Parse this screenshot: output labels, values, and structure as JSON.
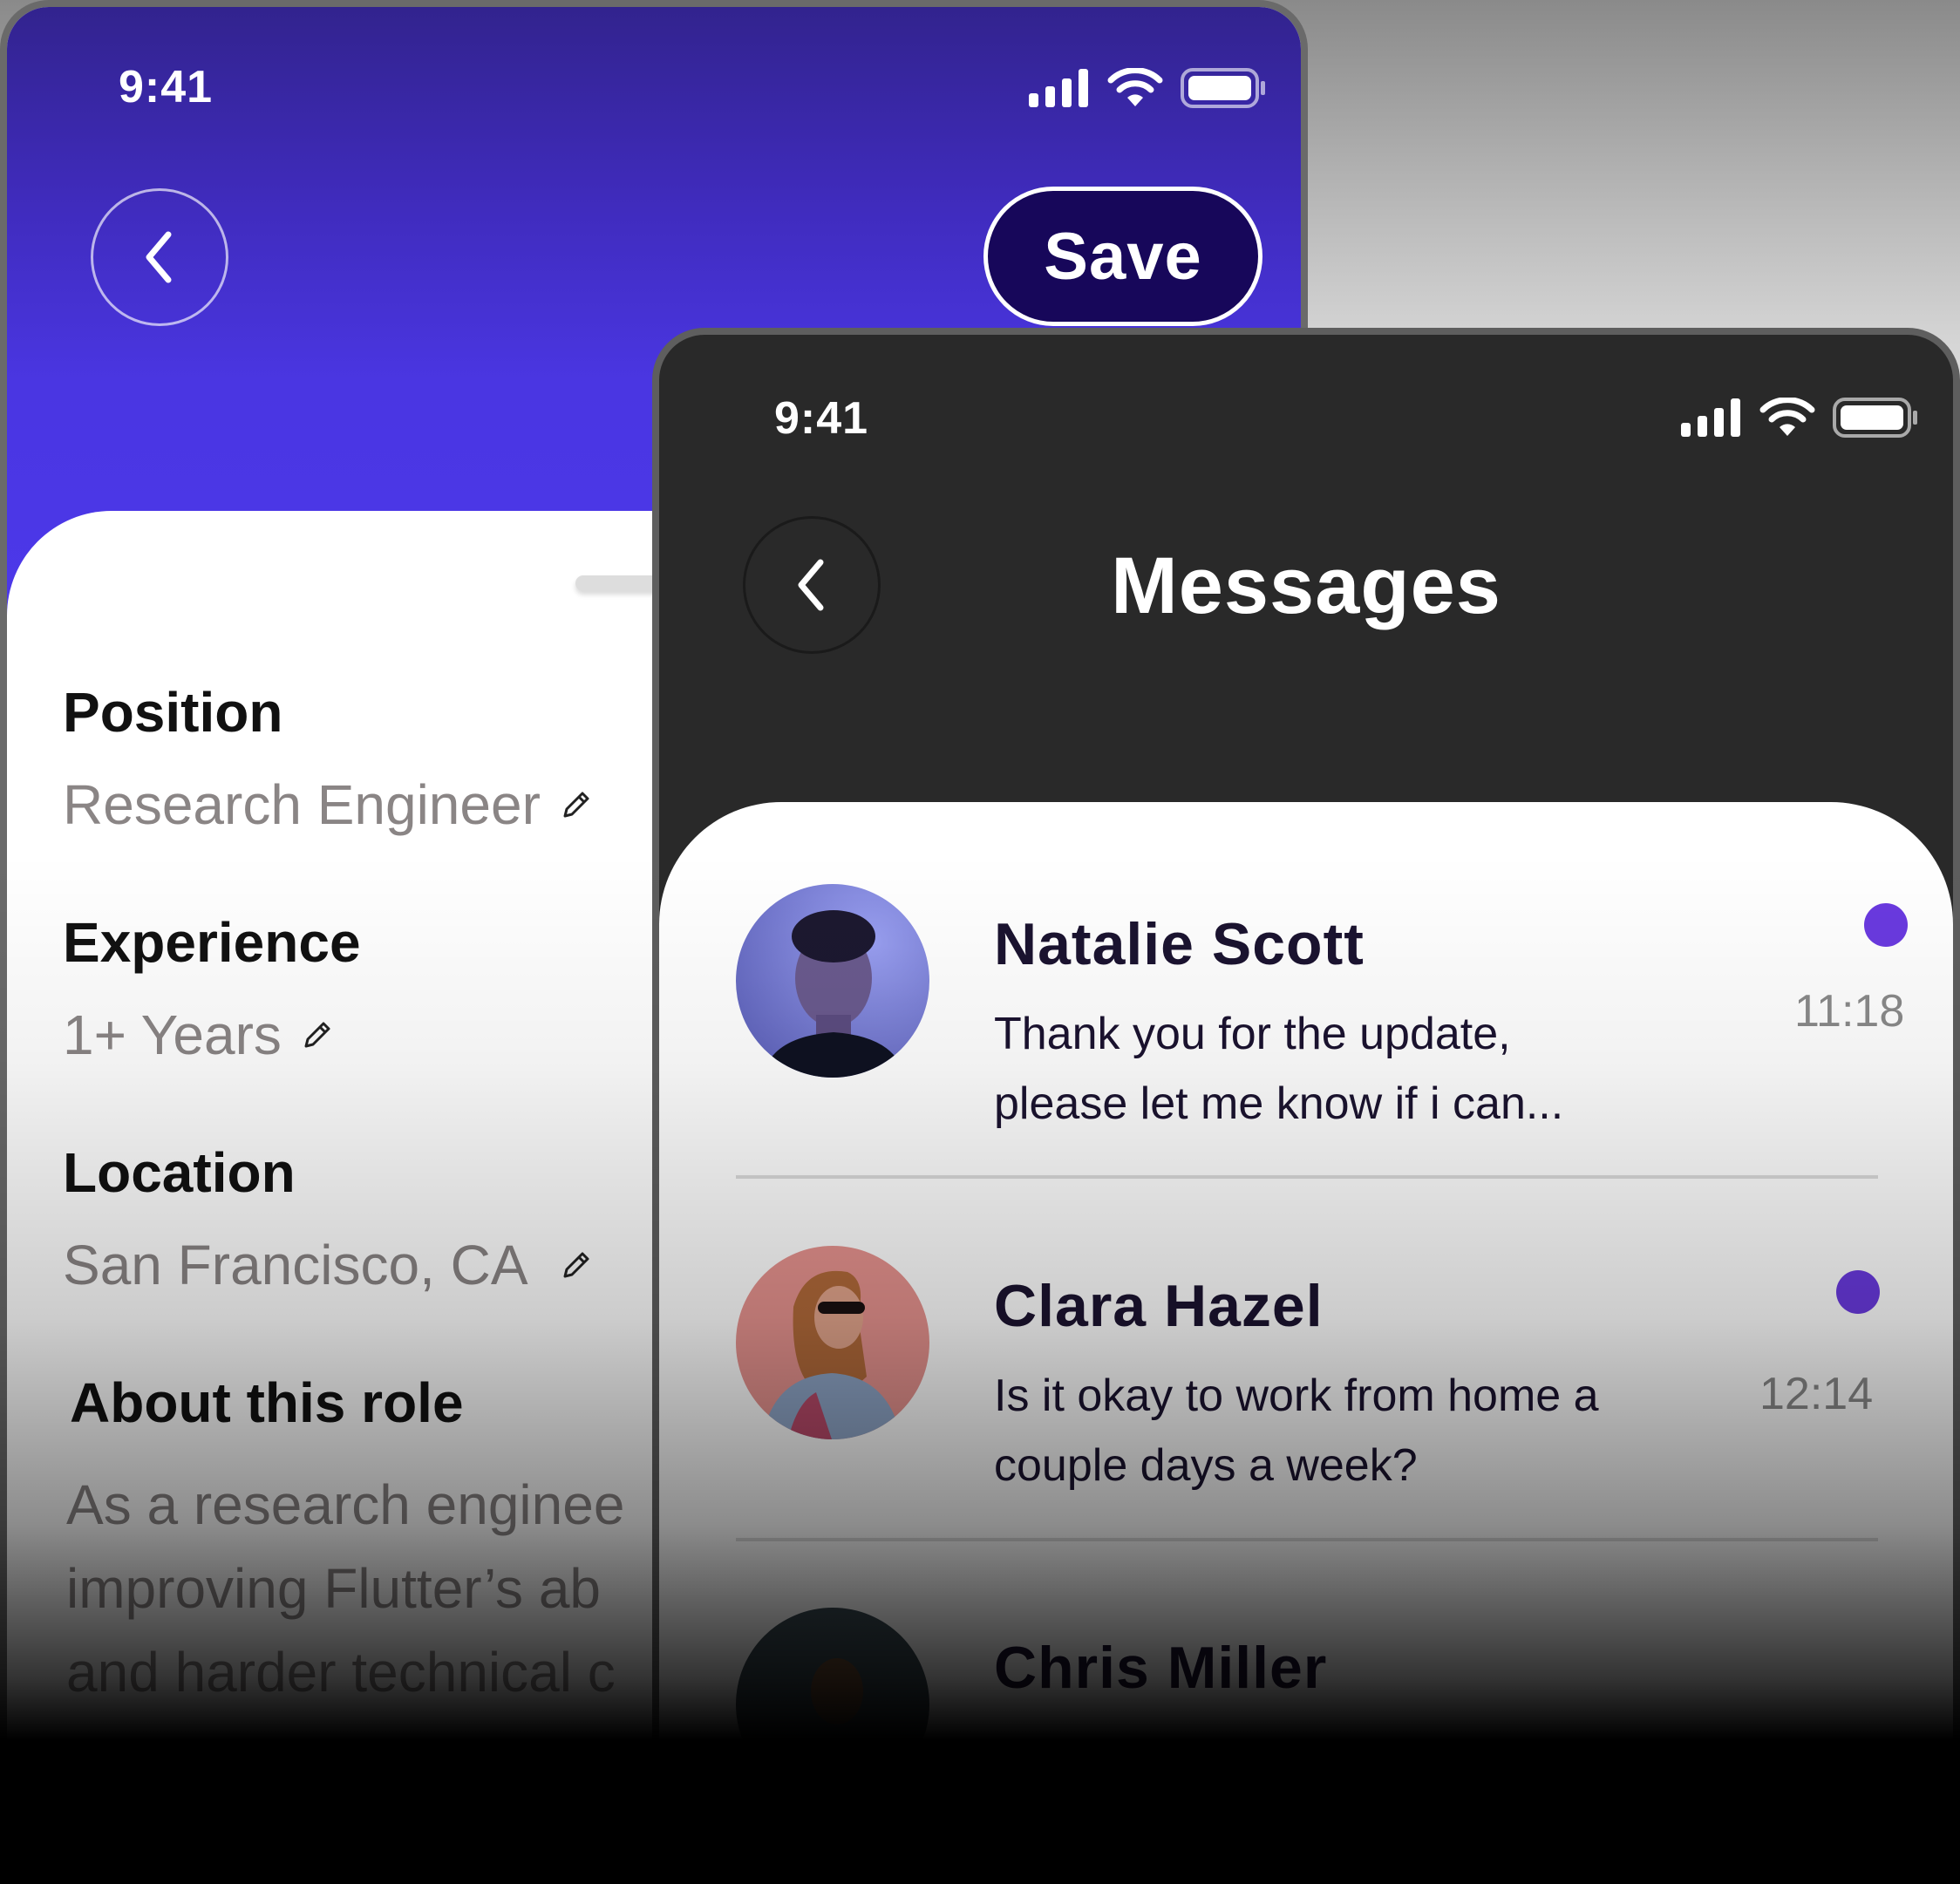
{
  "profile_screen": {
    "status_bar": {
      "time": "9:41"
    },
    "save_label": "Save",
    "fields": [
      {
        "label": "Position",
        "value": "Research Engineer"
      },
      {
        "label": "Experience",
        "value": "1+ Years"
      },
      {
        "label": "Location",
        "value": "San Francisco, CA"
      }
    ],
    "about": {
      "label": "About this role",
      "text": "As a research engineer … improving Flutter’s ab… and harder technical c…",
      "lines": [
        "As a research enginee",
        "improving Flutter’s ab",
        "and harder technical c"
      ]
    }
  },
  "messages_screen": {
    "status_bar": {
      "time": "9:41"
    },
    "title": "Messages",
    "conversations": [
      {
        "name": "Natalie Scott",
        "preview_lines": [
          "Thank you for the update,",
          "please let me know if i can..."
        ],
        "time": "11:18",
        "unread": true
      },
      {
        "name": "Clara Hazel",
        "preview_lines": [
          "Is it okay to work from home a",
          "couple days a week?"
        ],
        "time": "12:14",
        "unread": true
      },
      {
        "name": "Chris Miller",
        "preview_lines": [],
        "time": "",
        "unread": false
      }
    ]
  },
  "icons": {
    "back": "chevron-left-icon",
    "edit": "pencil-icon",
    "signal": "cellular-signal-icon",
    "wifi": "wifi-icon",
    "battery": "battery-icon"
  },
  "colors": {
    "profile_header_top": "#32238e",
    "profile_header_bottom": "#4c38ea",
    "save_button": "#17075a",
    "messages_header": "#292929",
    "unread_dot": "#6a3ae0"
  }
}
